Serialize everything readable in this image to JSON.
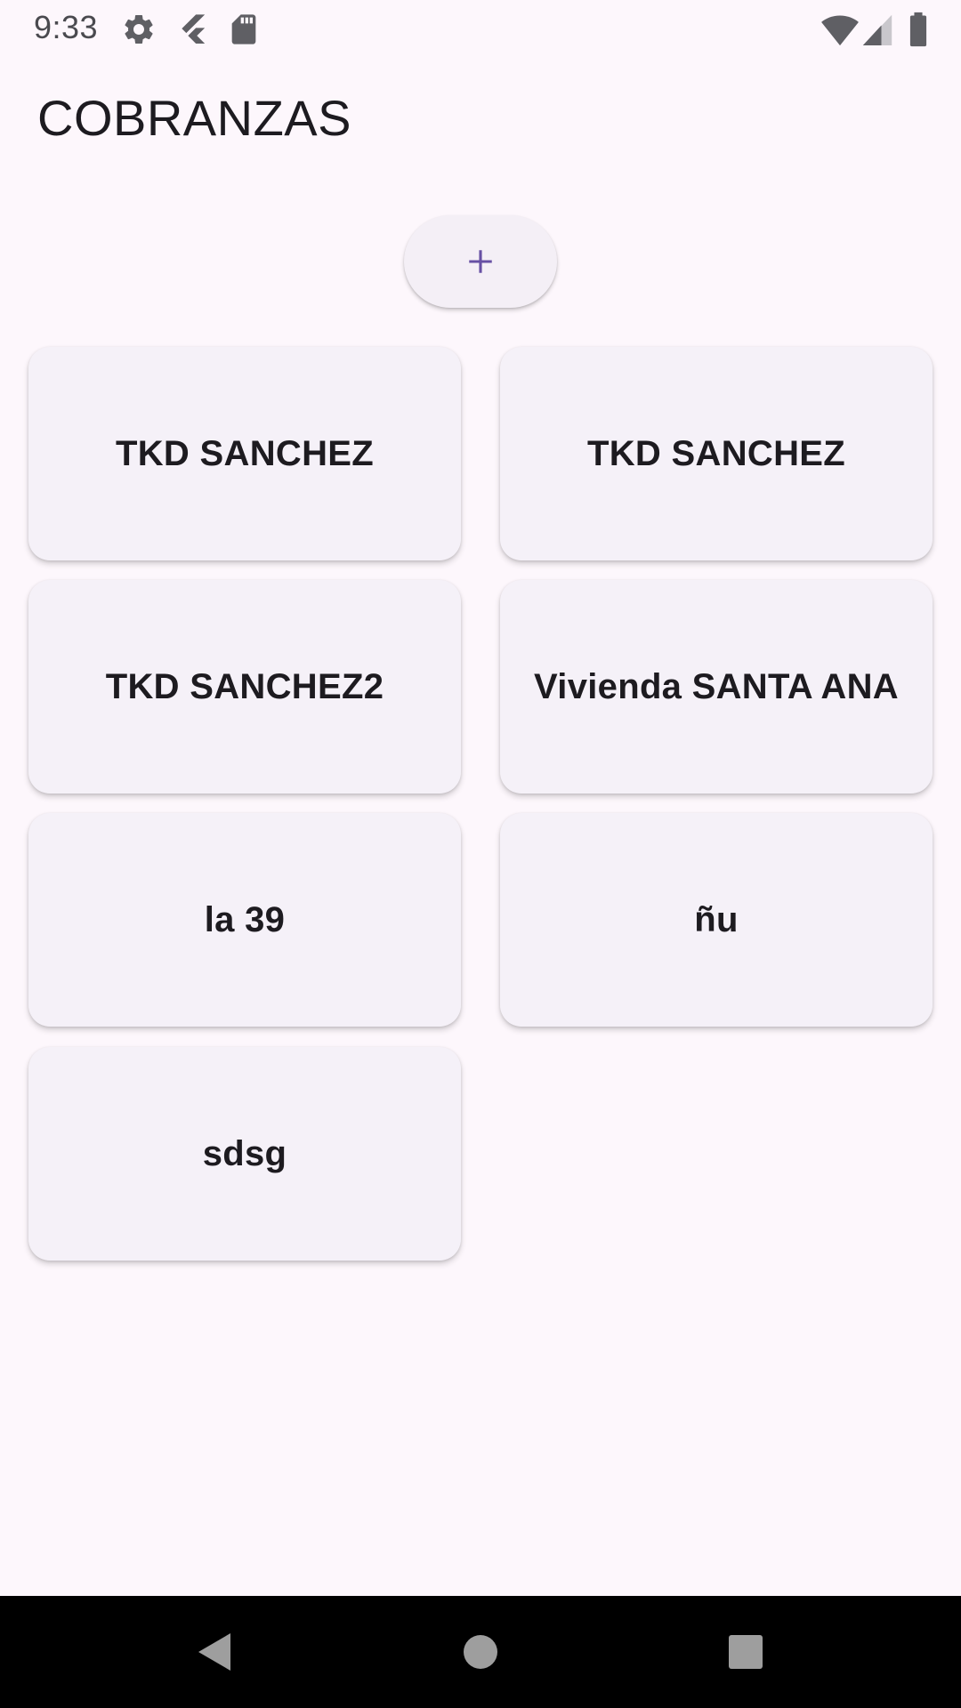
{
  "status_bar": {
    "time": "9:33",
    "left_icons": [
      "gear-icon",
      "flutter-icon",
      "sd-card-icon"
    ],
    "right_icons": [
      "wifi-icon",
      "signal-icon",
      "battery-icon"
    ]
  },
  "app_bar": {
    "title": "COBRANZAS"
  },
  "add_button": {
    "icon": "plus-icon",
    "color": "#6750a4"
  },
  "cards": [
    {
      "label": "TKD SANCHEZ"
    },
    {
      "label": "TKD SANCHEZ"
    },
    {
      "label": "TKD SANCHEZ2"
    },
    {
      "label": "Vivienda SANTA ANA"
    },
    {
      "label": "la 39"
    },
    {
      "label": "ñu"
    },
    {
      "label": "sdsg"
    }
  ],
  "nav_bar": {
    "buttons": [
      "back-icon",
      "home-icon",
      "recents-icon"
    ]
  },
  "colors": {
    "background": "#fdf7fc",
    "card": "#f5f1f8",
    "text": "#1d1b20",
    "accent": "#6750a4",
    "nav_bar": "#000000"
  }
}
